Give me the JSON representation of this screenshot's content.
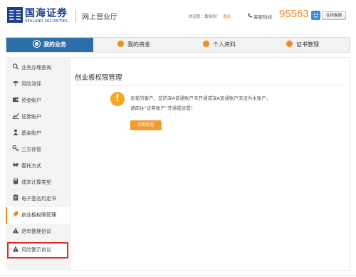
{
  "header": {
    "logo_cn": "国海证券",
    "logo_en": "SEALAND SECURITIES",
    "hall_title": "网上营业厅",
    "welcome": "欢迎您：黄晓玲！",
    "logout": "退出",
    "hotline_label": "客服热线",
    "hotline_number": "95563",
    "cs_button": "在线客服"
  },
  "nav": {
    "items": [
      {
        "label": "我的业务",
        "active": true,
        "icon": "business-icon"
      },
      {
        "label": "我的资金",
        "active": false,
        "icon": "funds-icon"
      },
      {
        "label": "个人资料",
        "active": false,
        "icon": "profile-icon"
      },
      {
        "label": "证书管理",
        "active": false,
        "icon": "certificate-icon"
      }
    ]
  },
  "sidebar": {
    "items": [
      {
        "label": "业务办理查询",
        "icon": "search-icon"
      },
      {
        "label": "风险测评",
        "icon": "umbrella-icon"
      },
      {
        "label": "资金账户",
        "icon": "wallet-icon"
      },
      {
        "label": "证券账户",
        "icon": "chart-icon"
      },
      {
        "label": "基金账户",
        "icon": "user-icon"
      },
      {
        "label": "三方存管",
        "icon": "key-icon"
      },
      {
        "label": "委托方式",
        "icon": "handshake-icon"
      },
      {
        "label": "成本计算类型",
        "icon": "calculator-icon"
      },
      {
        "label": "电子签名约定书",
        "icon": "document-icon"
      },
      {
        "label": "创业板权限管理",
        "icon": "rocket-icon"
      },
      {
        "label": "退市整理协议",
        "icon": "triangle-icon"
      },
      {
        "label": "风险警示协议",
        "icon": "warning-icon"
      }
    ]
  },
  "main": {
    "title": "创业板权限管理",
    "message_line1": "亲爱的客户，您的深A普通账户未开通或深A普通账户未设为主账户，",
    "message_line2": "请前往“证券账户”开通或设置！",
    "go_button": "立即前往"
  },
  "colors": {
    "brand_blue": "#1a3f8c",
    "nav_active": "#2c6ea8",
    "accent_orange": "#f08a1c",
    "highlight_red": "#e02a2a"
  }
}
